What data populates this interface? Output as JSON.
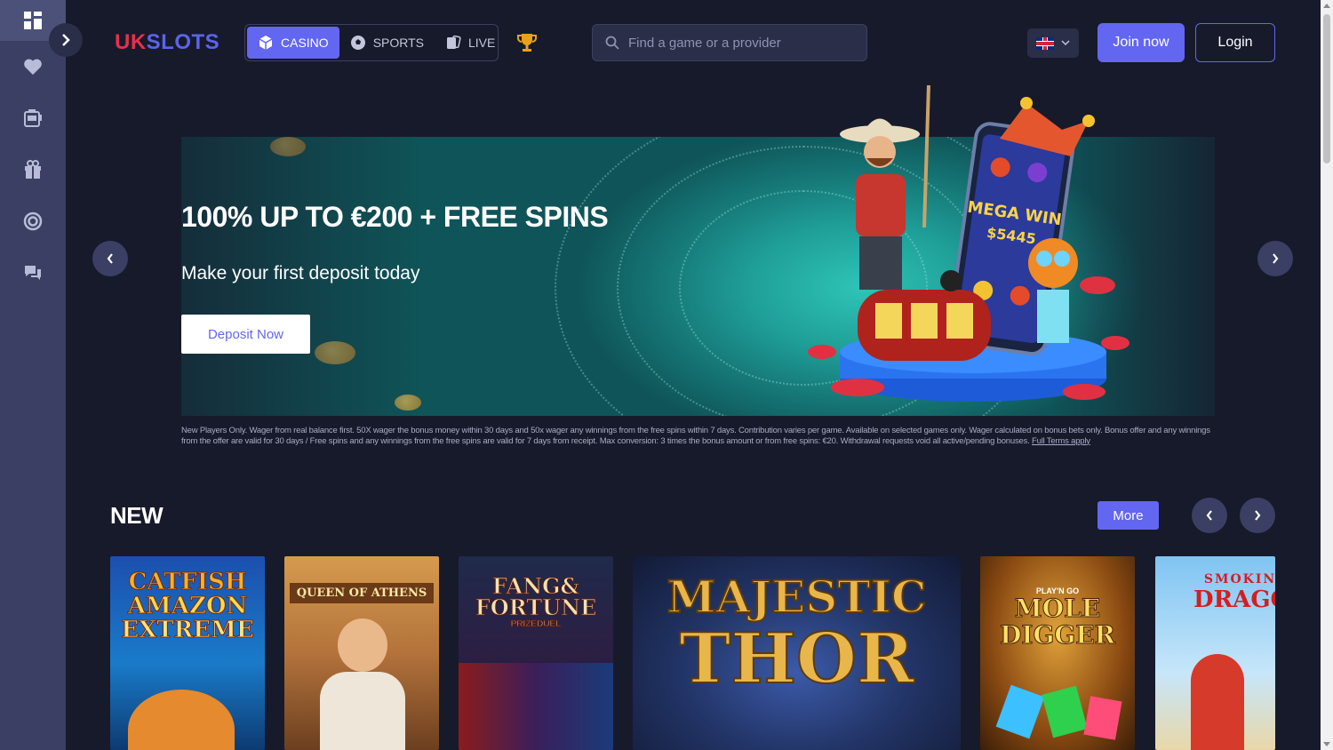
{
  "brand": {
    "logo_uk": "UK",
    "logo_slots": "SLOTS"
  },
  "nav": {
    "tabs": [
      {
        "label": "CASINO",
        "icon": "cube-icon",
        "active": true
      },
      {
        "label": "SPORTS",
        "icon": "soccer-ball-icon",
        "active": false
      },
      {
        "label": "LIVE",
        "icon": "cards-icon",
        "active": false
      }
    ],
    "trophy_icon": "trophy-icon"
  },
  "search": {
    "placeholder": "Find a game or a provider",
    "value": ""
  },
  "header": {
    "join_label": "Join now",
    "login_label": "Login",
    "language": "en-GB"
  },
  "sidebar": {
    "items": [
      {
        "icon": "dashboard-icon",
        "active": true
      },
      {
        "icon": "heart-icon"
      },
      {
        "icon": "slot-machine-icon"
      },
      {
        "icon": "gift-icon"
      },
      {
        "icon": "target-icon"
      },
      {
        "icon": "support-chat-icon"
      }
    ]
  },
  "banner": {
    "headline": "100% UP TO €200 + FREE SPINS",
    "subline": "Make your first deposit today",
    "cta": "Deposit Now",
    "terms": "New Players Only. Wager from real balance first. 50X wager the bonus money within 30 days and 50x wager any winnings from the free spins within 7 days. Contribution varies per game. Available on selected games only. Wager calculated on bonus bets only. Bonus offer and any winnings from the offer are valid for 30 days / Free spins and any winnings from the free spins are valid for 7 days from receipt. Max conversion: 3 times the bonus amount or from free spins: €20. Withdrawal requests void all active/pending bonuses.",
    "terms_link": "Full Terms apply",
    "phone_text_1": "MEGA WIN",
    "phone_text_2": "$5445"
  },
  "new_section": {
    "title": "NEW",
    "more_label": "More",
    "games": [
      {
        "line1": "CATFISH",
        "line2": "AMAZON",
        "line3": "EXTREME"
      },
      {
        "line1": "QUEEN OF ATHENS"
      },
      {
        "line1": "FANG&",
        "line2": "FORTUNE",
        "line3": "PRIZEDUEL"
      },
      {
        "line1": "MAJESTIC",
        "line2": "THOR"
      },
      {
        "line1": "PLAY'N GO",
        "line2": "MOLE",
        "line3": "DIGGER"
      },
      {
        "line1": "SMOKING",
        "line2": "DRAGON"
      }
    ]
  },
  "colors": {
    "accent": "#6366f1",
    "background": "#171a2b",
    "rail": "#3a3f63",
    "logo_red": "#e5314c"
  }
}
